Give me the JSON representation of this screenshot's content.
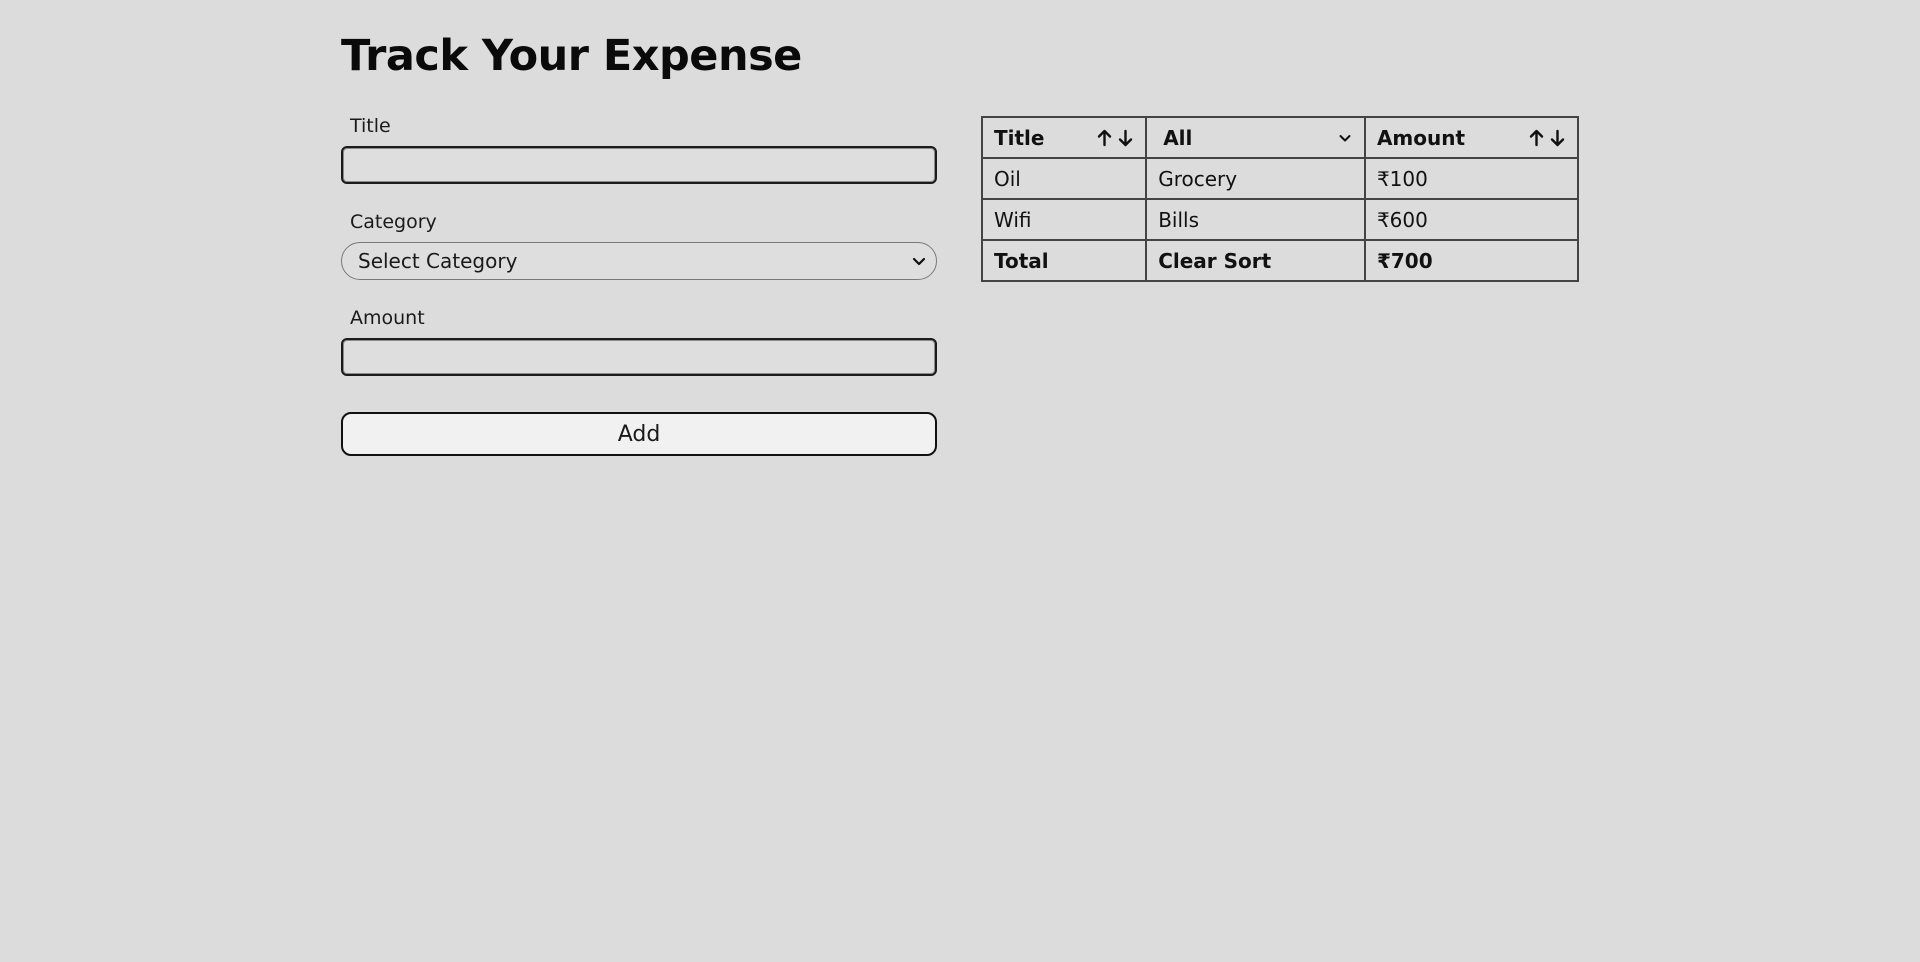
{
  "header": {
    "title": "Track Your Expense"
  },
  "form": {
    "title_label": "Title",
    "title_value": "",
    "category_label": "Category",
    "category_selected": "Select Category",
    "amount_label": "Amount",
    "amount_value": "",
    "add_label": "Add"
  },
  "table": {
    "headers": {
      "title": "Title",
      "category_filter": "All",
      "amount": "Amount"
    },
    "rows": [
      {
        "title": "Oil",
        "category": "Grocery",
        "amount": "₹100"
      },
      {
        "title": "Wifi",
        "category": "Bills",
        "amount": "₹600"
      }
    ],
    "footer": {
      "label": "Total",
      "clear_sort": "Clear Sort",
      "total": "₹700"
    }
  },
  "icons": {
    "sort_up": "arrow-up-icon",
    "sort_down": "arrow-down-icon",
    "dropdown": "chevron-down-icon"
  }
}
